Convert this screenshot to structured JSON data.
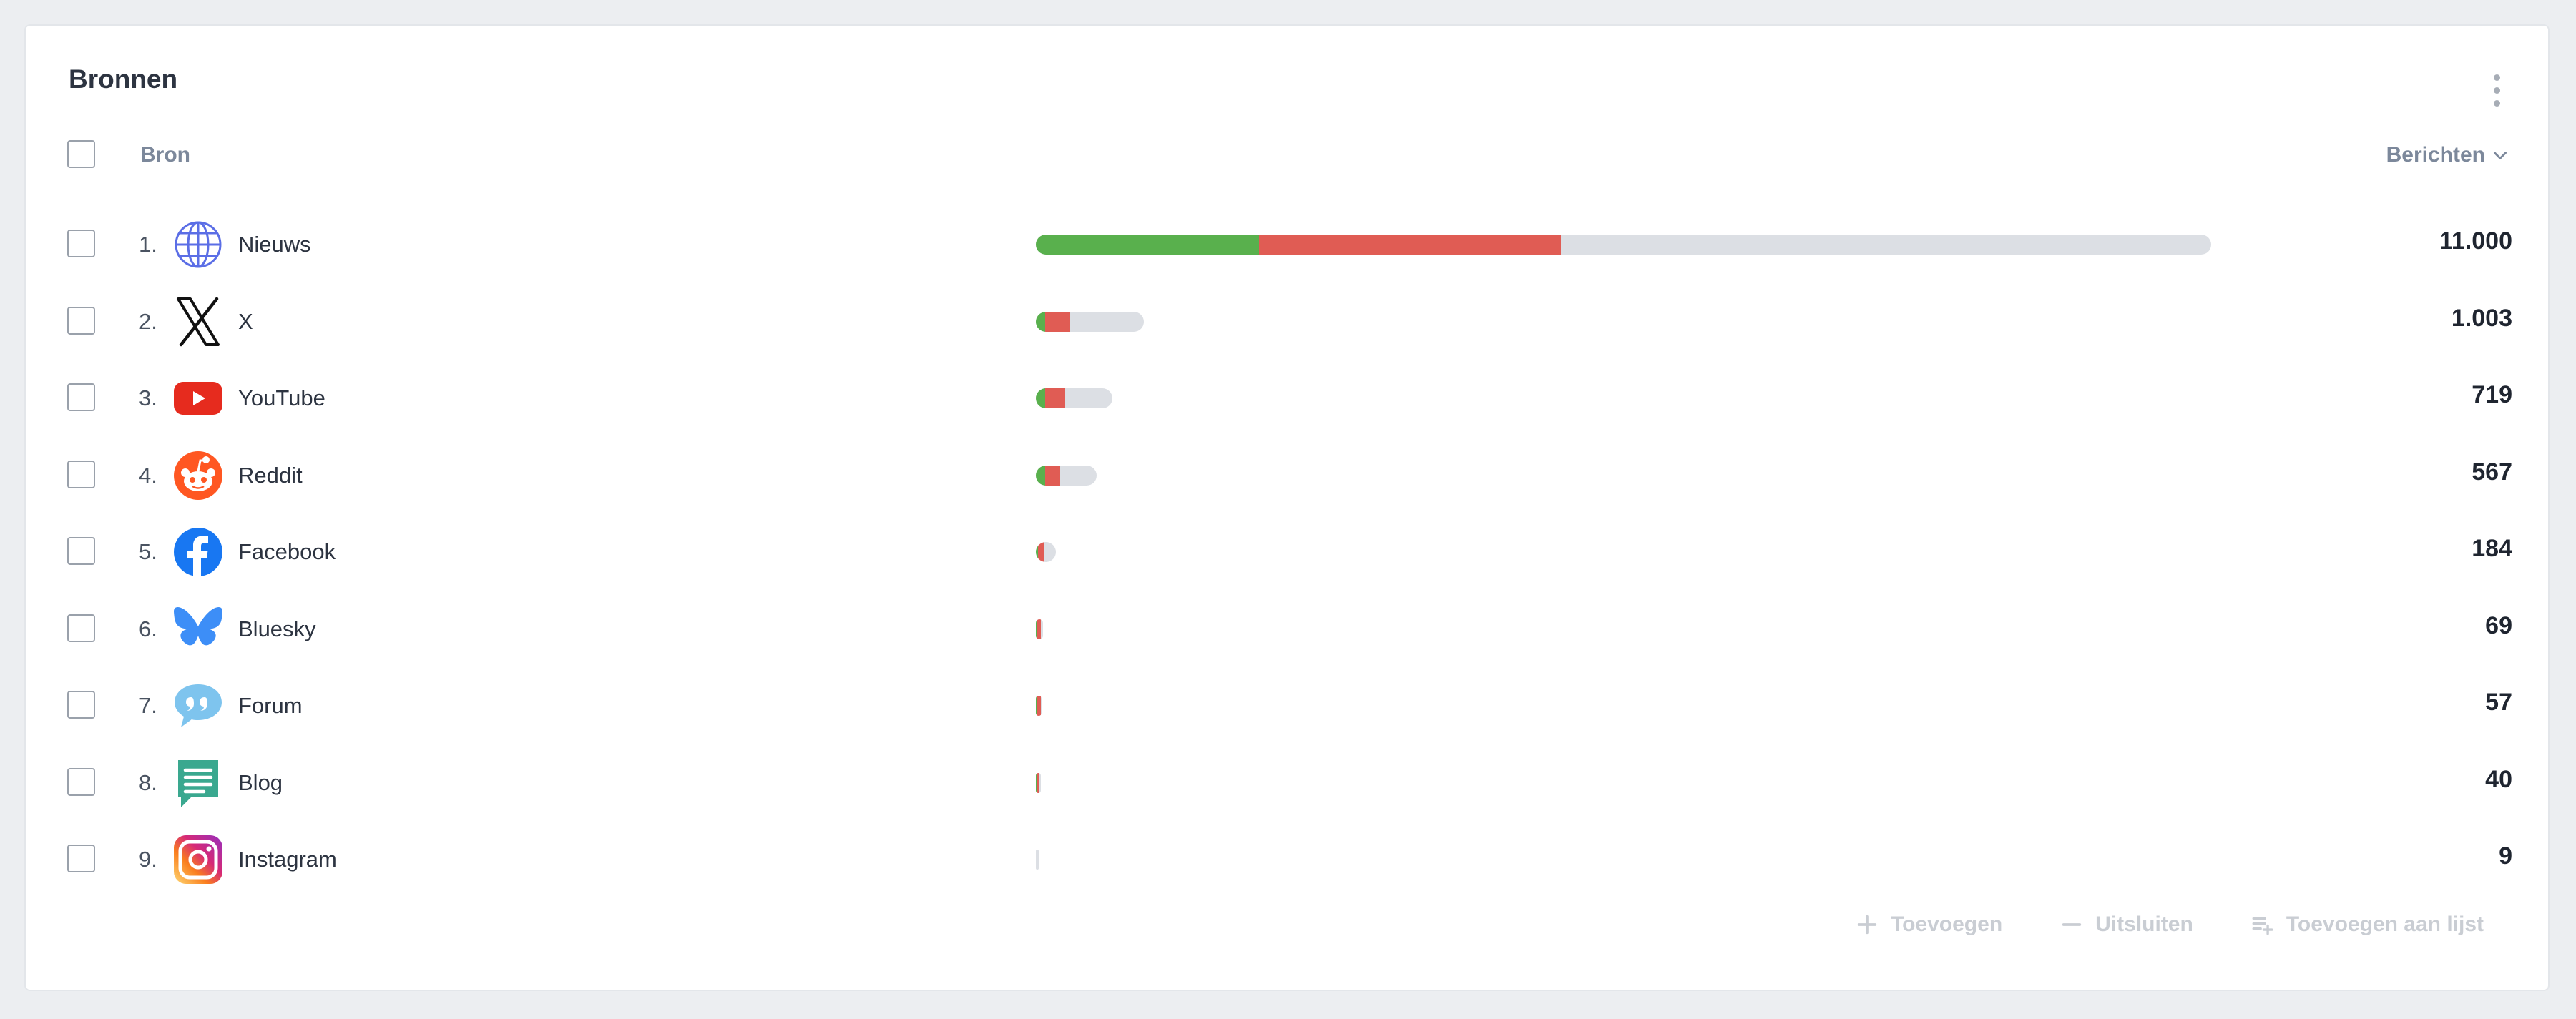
{
  "card": {
    "title": "Bronnen"
  },
  "table": {
    "col_source": "Bron",
    "col_count": "Berichten",
    "rows": [
      {
        "rank": "1.",
        "name": "Nieuws",
        "count": "11.000",
        "icon": "globe-icon",
        "bar_fraction": 1.0,
        "positive_fraction": 0.19,
        "negative_fraction": 0.257
      },
      {
        "rank": "2.",
        "name": "X",
        "count": "1.003",
        "icon": "x-logo-icon",
        "bar_fraction": 0.092,
        "positive_fraction": 0.008,
        "negative_fraction": 0.021
      },
      {
        "rank": "3.",
        "name": "YouTube",
        "count": "719",
        "icon": "youtube-icon",
        "bar_fraction": 0.065,
        "positive_fraction": 0.008,
        "negative_fraction": 0.017
      },
      {
        "rank": "4.",
        "name": "Reddit",
        "count": "567",
        "icon": "reddit-icon",
        "bar_fraction": 0.052,
        "positive_fraction": 0.008,
        "negative_fraction": 0.013
      },
      {
        "rank": "5.",
        "name": "Facebook",
        "count": "184",
        "icon": "facebook-icon",
        "bar_fraction": 0.017,
        "positive_fraction": 0.002,
        "negative_fraction": 0.005
      },
      {
        "rank": "6.",
        "name": "Bluesky",
        "count": "69",
        "icon": "bluesky-icon",
        "bar_fraction": 0.006,
        "positive_fraction": 0.001,
        "negative_fraction": 0.003
      },
      {
        "rank": "7.",
        "name": "Forum",
        "count": "57",
        "icon": "forum-icon",
        "bar_fraction": 0.005,
        "positive_fraction": 0.001,
        "negative_fraction": 0.003
      },
      {
        "rank": "8.",
        "name": "Blog",
        "count": "40",
        "icon": "blog-icon",
        "bar_fraction": 0.004,
        "positive_fraction": 0.001,
        "negative_fraction": 0.002
      },
      {
        "rank": "9.",
        "name": "Instagram",
        "count": "9",
        "icon": "instagram-icon",
        "bar_fraction": 0.001,
        "positive_fraction": 0.0,
        "negative_fraction": 0.0
      }
    ]
  },
  "actions": {
    "add": "Toevoegen",
    "exclude": "Uitsluiten",
    "add_to_list": "Toevoegen aan lijst"
  },
  "colors": {
    "positive": "#59b04d",
    "negative": "#e05c54",
    "neutral": "#dcdfe4"
  }
}
